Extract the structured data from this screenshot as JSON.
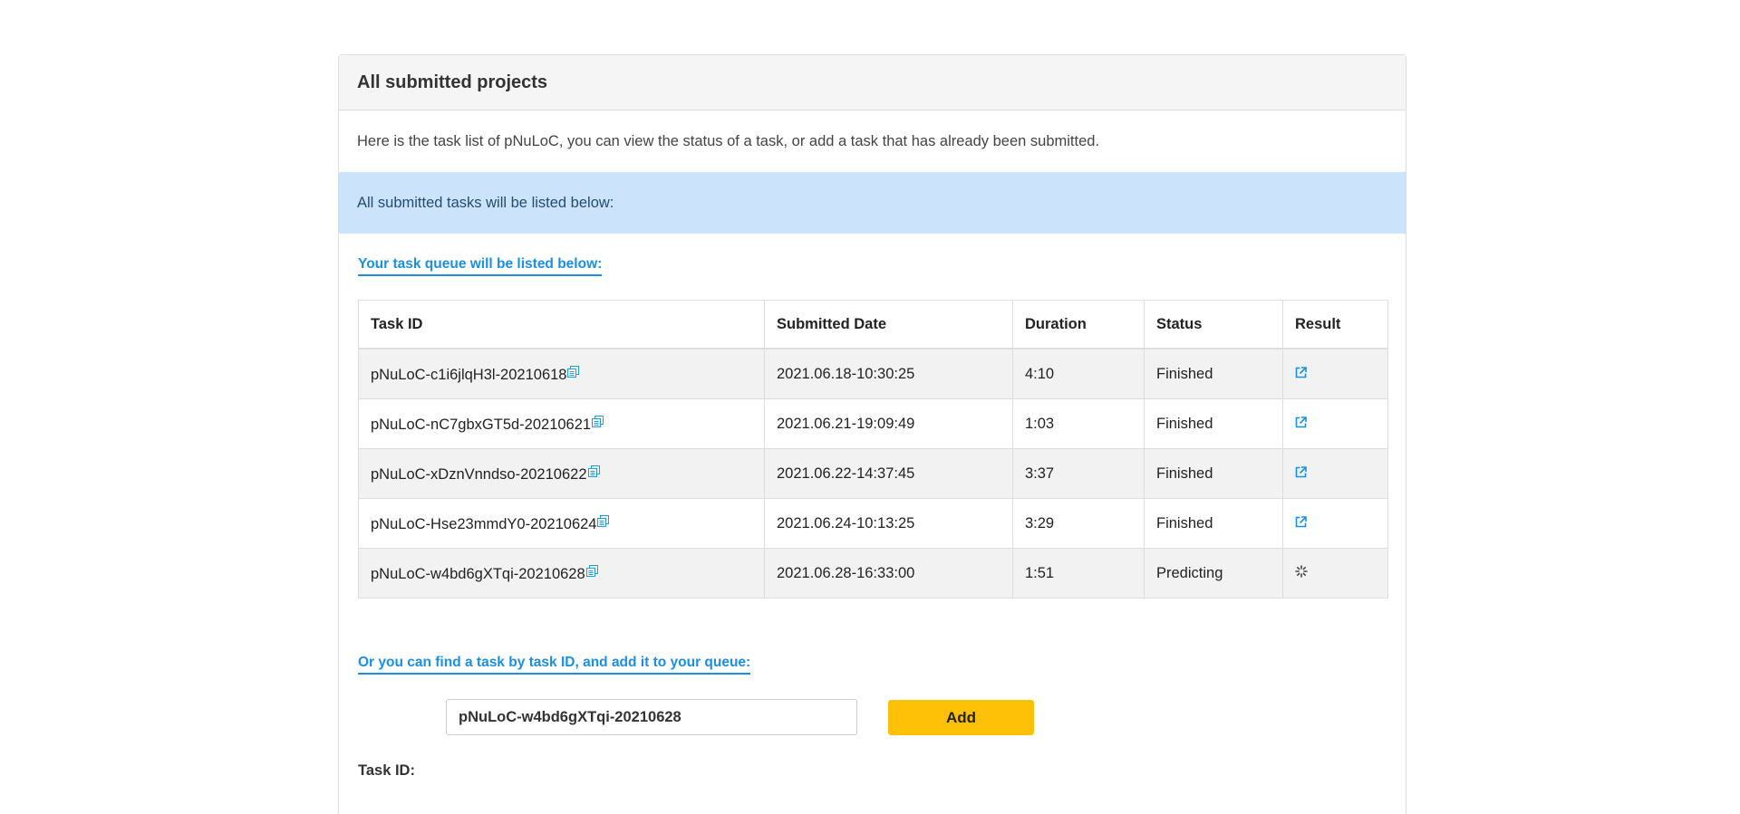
{
  "panel": {
    "title": "All submitted projects",
    "intro": "Here is the task list of pNuLoC, you can view the status of a task, or add a task that has already been submitted.",
    "info": "All submitted tasks will be listed below:"
  },
  "queue": {
    "link_label": "Your task queue will be listed below:",
    "headers": {
      "task_id": "Task ID",
      "submitted_date": "Submitted Date",
      "duration": "Duration",
      "status": "Status",
      "result": "Result"
    },
    "rows": [
      {
        "task_id": "pNuLoC-c1i6jlqH3l-20210618",
        "submitted_date": "2021.06.18-10:30:25",
        "duration": "4:10",
        "status": "Finished",
        "result_icon": "external-link-icon"
      },
      {
        "task_id": "pNuLoC-nC7gbxGT5d-20210621",
        "submitted_date": "2021.06.21-19:09:49",
        "duration": "1:03",
        "status": "Finished",
        "result_icon": "external-link-icon"
      },
      {
        "task_id": "pNuLoC-xDznVnndso-20210622",
        "submitted_date": "2021.06.22-14:37:45",
        "duration": "3:37",
        "status": "Finished",
        "result_icon": "external-link-icon"
      },
      {
        "task_id": "pNuLoC-Hse23mmdY0-20210624",
        "submitted_date": "2021.06.24-10:13:25",
        "duration": "3:29",
        "status": "Finished",
        "result_icon": "external-link-icon"
      },
      {
        "task_id": "pNuLoC-w4bd6gXTqi-20210628",
        "submitted_date": "2021.06.28-16:33:00",
        "duration": "1:51",
        "status": "Predicting",
        "result_icon": "spinner-icon"
      }
    ]
  },
  "find": {
    "link_label": "Or you can find a task by task ID, and add it to your queue:",
    "field_label": "Task ID:",
    "input_value": "pNuLoC-w4bd6gXTqi-20210628",
    "add_label": "Add"
  },
  "colors": {
    "heading_bg": "#f5f5f5",
    "info_bg": "#cce4fb",
    "link": "#1a8fe3",
    "duration": "#e53935",
    "finished": "#7cb342",
    "predicting": "#1a9fe0",
    "add_button": "#ffc107"
  }
}
